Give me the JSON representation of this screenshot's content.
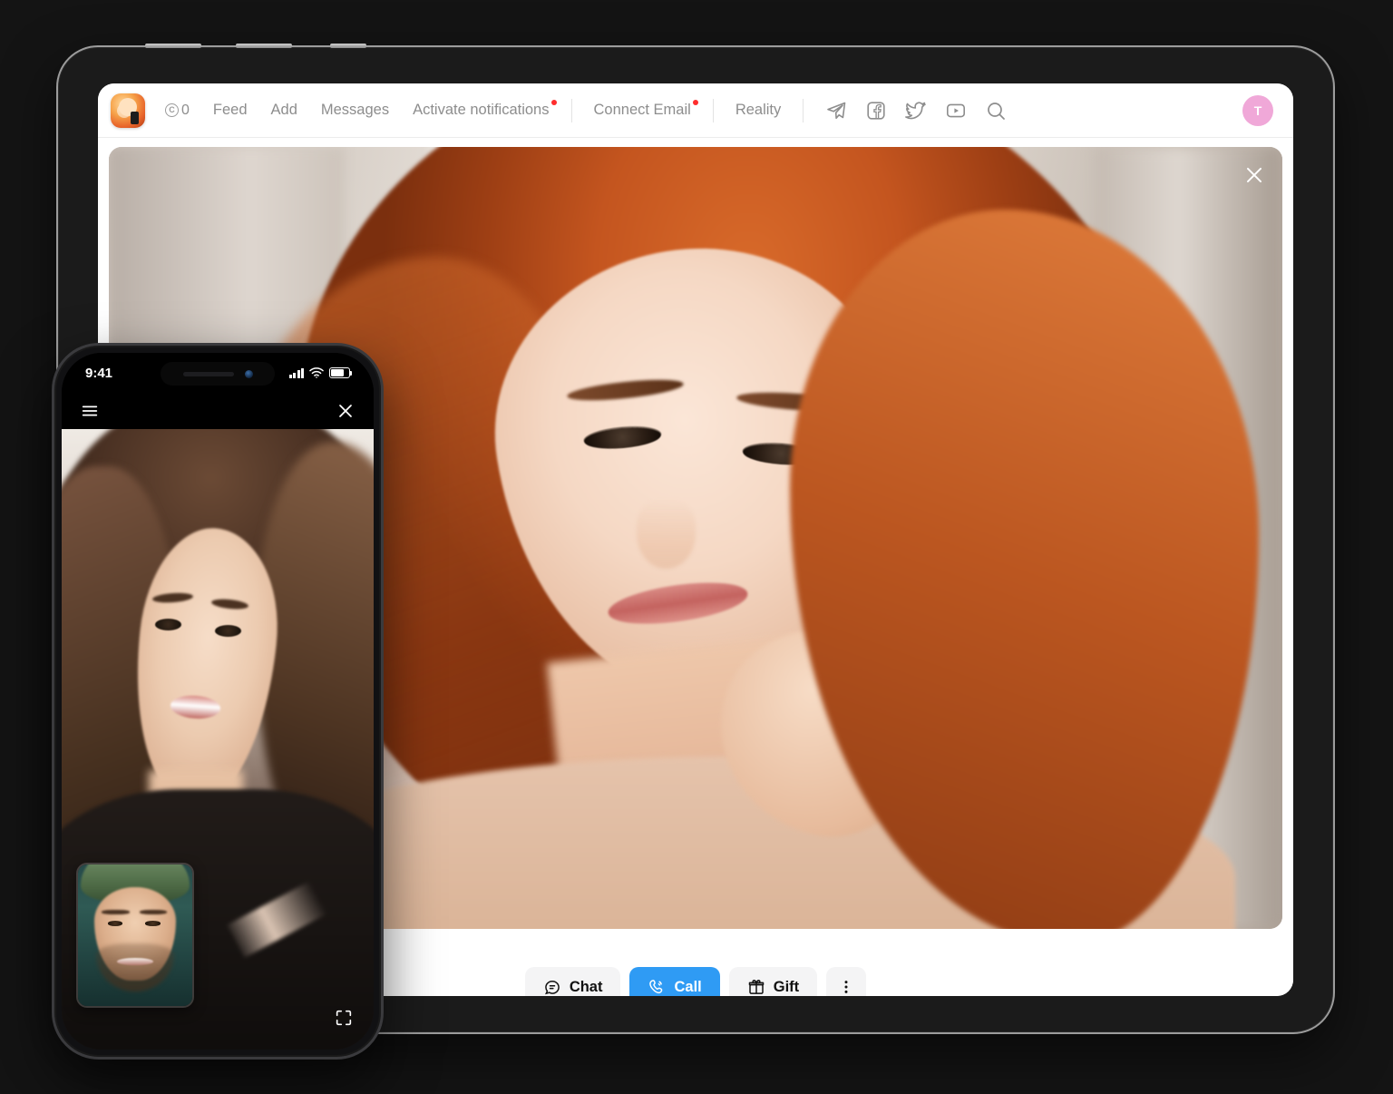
{
  "background_color": "#141414",
  "tablet": {
    "nav": {
      "logo_alt": "app-logo",
      "credits": {
        "icon": "coin-icon",
        "symbol": "C",
        "value": "0"
      },
      "links": [
        {
          "label": "Feed",
          "badge": false
        },
        {
          "label": "Add",
          "badge": false
        },
        {
          "label": "Messages",
          "badge": false
        },
        {
          "label": "Activate notifications",
          "badge": true
        },
        {
          "label": "Connect Email",
          "badge": true
        },
        {
          "label": "Reality",
          "badge": false
        }
      ],
      "icons": [
        {
          "name": "telegram-icon"
        },
        {
          "name": "facebook-icon"
        },
        {
          "name": "twitter-icon"
        },
        {
          "name": "youtube-icon"
        },
        {
          "name": "search-icon"
        }
      ],
      "avatar": {
        "initial": "T",
        "color": "#f0a8d8"
      }
    },
    "video": {
      "close_icon": "close-icon",
      "subject": "woman-with-red-hair"
    },
    "actions": [
      {
        "label": "Chat",
        "icon": "chat-icon",
        "primary": false
      },
      {
        "label": "Call",
        "icon": "phone-call-icon",
        "primary": true
      },
      {
        "label": "Gift",
        "icon": "gift-icon",
        "primary": false
      },
      {
        "label": "",
        "icon": "more-vertical-icon",
        "primary": false
      }
    ],
    "accent_color": "#2f9bf4"
  },
  "phone": {
    "status_bar": {
      "time": "9:41",
      "signal_icon": "cellular-signal-icon",
      "wifi_icon": "wifi-icon",
      "battery_icon": "battery-icon"
    },
    "topbar": {
      "menu_icon": "hamburger-menu-icon",
      "close_icon": "close-icon"
    },
    "video": {
      "subject": "woman-with-brown-hair"
    },
    "pip": {
      "subject": "man-with-green-cap"
    },
    "fullscreen_icon": "fullscreen-icon"
  }
}
